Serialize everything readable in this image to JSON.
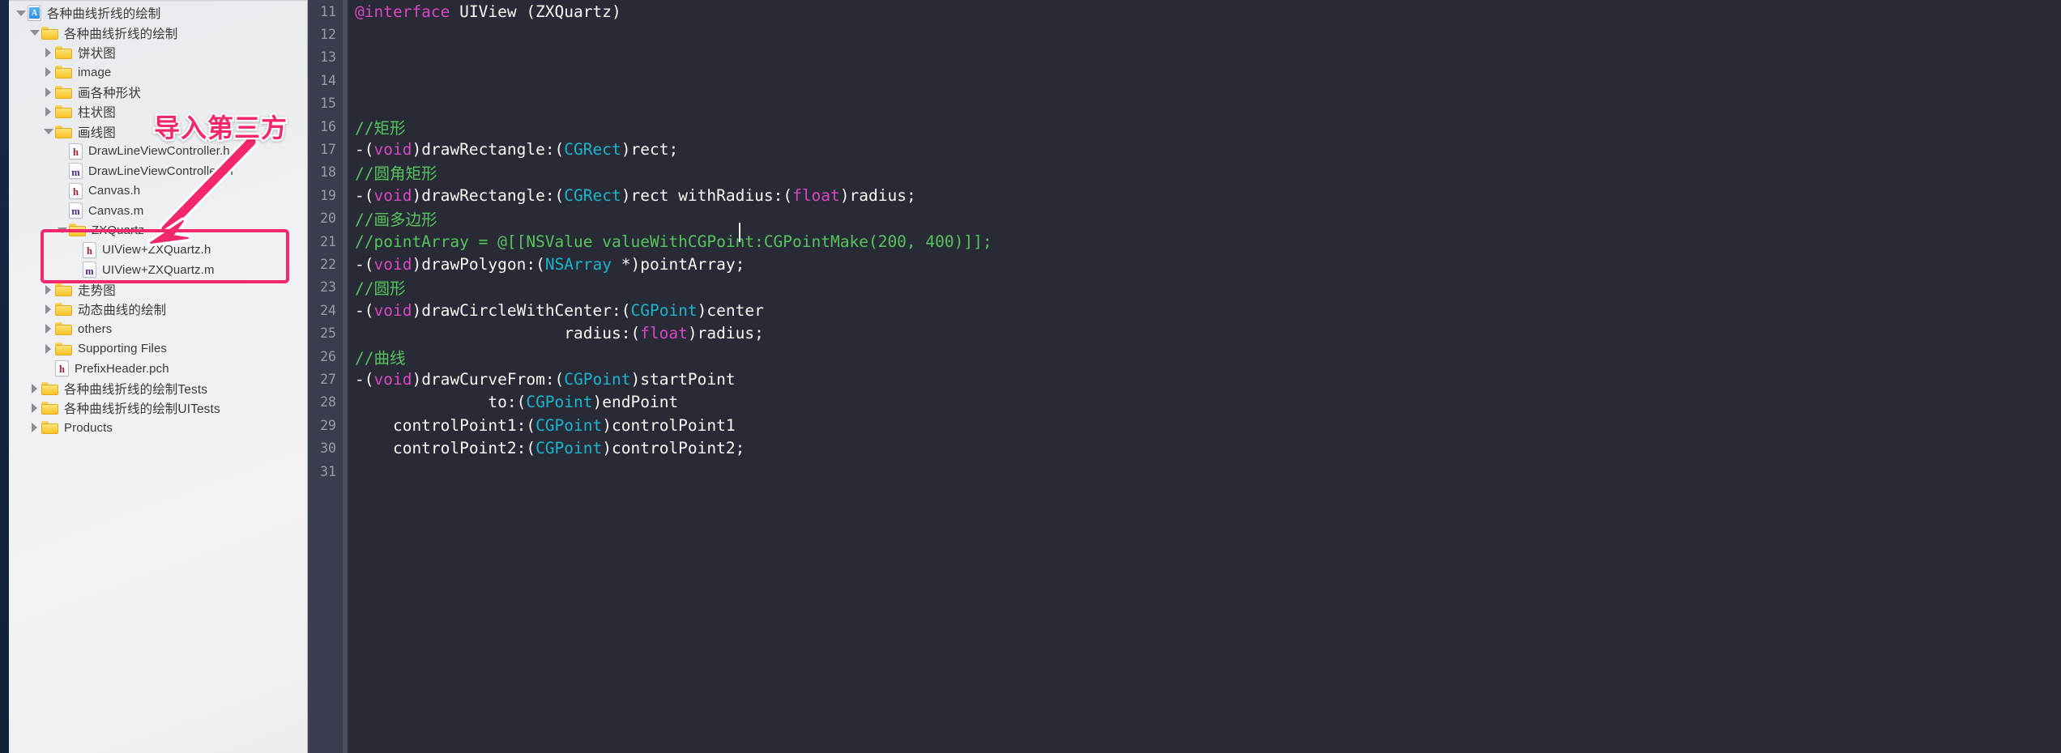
{
  "sidebar": {
    "name": "project-navigator",
    "items": [
      {
        "indent": 0,
        "twisty": "open",
        "icon": "app-icon",
        "label": "各种曲线折线的绘制"
      },
      {
        "indent": 1,
        "twisty": "open",
        "icon": "folder-icon",
        "label": "各种曲线折线的绘制"
      },
      {
        "indent": 2,
        "twisty": "closed",
        "icon": "folder-icon",
        "label": "饼状图"
      },
      {
        "indent": 2,
        "twisty": "closed",
        "icon": "folder-icon",
        "label": "image"
      },
      {
        "indent": 2,
        "twisty": "closed",
        "icon": "folder-icon",
        "label": "画各种形状"
      },
      {
        "indent": 2,
        "twisty": "closed",
        "icon": "folder-icon",
        "label": "柱状图"
      },
      {
        "indent": 2,
        "twisty": "open",
        "icon": "folder-icon",
        "label": "画线图"
      },
      {
        "indent": 3,
        "twisty": "none",
        "icon": "header-file-icon",
        "label": "DrawLineViewController.h"
      },
      {
        "indent": 3,
        "twisty": "none",
        "icon": "source-file-icon",
        "label": "DrawLineViewController.m"
      },
      {
        "indent": 3,
        "twisty": "none",
        "icon": "header-file-icon",
        "label": "Canvas.h"
      },
      {
        "indent": 3,
        "twisty": "none",
        "icon": "source-file-icon",
        "label": "Canvas.m"
      },
      {
        "indent": 3,
        "twisty": "open",
        "icon": "folder-icon",
        "label": "ZXQuartz"
      },
      {
        "indent": 4,
        "twisty": "none",
        "icon": "header-file-icon",
        "label": "UIView+ZXQuartz.h"
      },
      {
        "indent": 4,
        "twisty": "none",
        "icon": "source-file-icon",
        "label": "UIView+ZXQuartz.m"
      },
      {
        "indent": 2,
        "twisty": "closed",
        "icon": "folder-icon",
        "label": "走势图"
      },
      {
        "indent": 2,
        "twisty": "closed",
        "icon": "folder-icon",
        "label": "动态曲线的绘制"
      },
      {
        "indent": 2,
        "twisty": "closed",
        "icon": "folder-icon",
        "label": "others"
      },
      {
        "indent": 2,
        "twisty": "closed",
        "icon": "folder-icon",
        "label": "Supporting Files"
      },
      {
        "indent": 2,
        "twisty": "none",
        "icon": "header-file-icon",
        "label": "PrefixHeader.pch"
      },
      {
        "indent": 1,
        "twisty": "closed",
        "icon": "folder-icon",
        "label": "各种曲线折线的绘制Tests"
      },
      {
        "indent": 1,
        "twisty": "closed",
        "icon": "folder-icon",
        "label": "各种曲线折线的绘制UITests"
      },
      {
        "indent": 1,
        "twisty": "closed",
        "icon": "folder-icon",
        "label": "Products"
      }
    ]
  },
  "annotation": {
    "text": "导入第三方",
    "color": "#f5276c",
    "outline_color": "#ffffff",
    "highlight_target": "ZXQuartz"
  },
  "editor": {
    "background": "#282a36",
    "gutter_background": "#3a3d4d",
    "line_number_color": "#9a9ca6",
    "first_line_number": 11,
    "last_line_number": 31,
    "colors": {
      "keyword": "#d946c4",
      "comment": "#56c45c",
      "type": "#19b6cf",
      "plain": "#f8f8f2"
    },
    "line_numbers": [
      11,
      12,
      13,
      14,
      15,
      16,
      17,
      18,
      19,
      20,
      21,
      22,
      23,
      24,
      25,
      26,
      27,
      28,
      29,
      30,
      31
    ],
    "lines": [
      {
        "n": 11,
        "tokens": [
          {
            "t": "@interface ",
            "c": "kw"
          },
          {
            "t": "UIView (ZXQuartz)",
            "c": "pl"
          }
        ]
      },
      {
        "n": 12,
        "tokens": []
      },
      {
        "n": 13,
        "tokens": []
      },
      {
        "n": 14,
        "tokens": []
      },
      {
        "n": 15,
        "tokens": []
      },
      {
        "n": 16,
        "tokens": [
          {
            "t": "//矩形",
            "c": "cm"
          }
        ]
      },
      {
        "n": 17,
        "tokens": [
          {
            "t": "-(",
            "c": "pl"
          },
          {
            "t": "void",
            "c": "kw"
          },
          {
            "t": ")drawRectangle:(",
            "c": "pl"
          },
          {
            "t": "CGRect",
            "c": "ty"
          },
          {
            "t": ")rect;",
            "c": "pl"
          }
        ]
      },
      {
        "n": 18,
        "tokens": [
          {
            "t": "//圆角矩形",
            "c": "cm"
          }
        ]
      },
      {
        "n": 19,
        "tokens": [
          {
            "t": "-(",
            "c": "pl"
          },
          {
            "t": "void",
            "c": "kw"
          },
          {
            "t": ")drawRectangle:(",
            "c": "pl"
          },
          {
            "t": "CGRect",
            "c": "ty"
          },
          {
            "t": ")rect withRadius:(",
            "c": "pl"
          },
          {
            "t": "float",
            "c": "kw"
          },
          {
            "t": ")radius;",
            "c": "pl"
          }
        ]
      },
      {
        "n": 20,
        "tokens": [
          {
            "t": "//画多边形",
            "c": "cm"
          }
        ]
      },
      {
        "n": 21,
        "tokens": [
          {
            "t": "//pointArray = @[[NSValue valueWithCGPoint:CGPointMake(200, 400)]];",
            "c": "cm"
          }
        ]
      },
      {
        "n": 22,
        "tokens": [
          {
            "t": "-(",
            "c": "pl"
          },
          {
            "t": "void",
            "c": "kw"
          },
          {
            "t": ")drawPolygon:(",
            "c": "pl"
          },
          {
            "t": "NSArray",
            "c": "ty"
          },
          {
            "t": " *)pointArray;",
            "c": "pl"
          }
        ]
      },
      {
        "n": 23,
        "tokens": [
          {
            "t": "//圆形",
            "c": "cm"
          }
        ]
      },
      {
        "n": 24,
        "tokens": [
          {
            "t": "-(",
            "c": "pl"
          },
          {
            "t": "void",
            "c": "kw"
          },
          {
            "t": ")drawCircleWithCenter:(",
            "c": "pl"
          },
          {
            "t": "CGPoint",
            "c": "ty"
          },
          {
            "t": ")center",
            "c": "pl"
          }
        ]
      },
      {
        "n": 25,
        "tokens": [
          {
            "t": "                      radius:(",
            "c": "pl"
          },
          {
            "t": "float",
            "c": "kw"
          },
          {
            "t": ")radius;",
            "c": "pl"
          }
        ]
      },
      {
        "n": 26,
        "tokens": [
          {
            "t": "//曲线",
            "c": "cm"
          }
        ]
      },
      {
        "n": 27,
        "tokens": [
          {
            "t": "-(",
            "c": "pl"
          },
          {
            "t": "void",
            "c": "kw"
          },
          {
            "t": ")drawCurveFrom:(",
            "c": "pl"
          },
          {
            "t": "CGPoint",
            "c": "ty"
          },
          {
            "t": ")startPoint",
            "c": "pl"
          }
        ]
      },
      {
        "n": 28,
        "tokens": [
          {
            "t": "              to:(",
            "c": "pl"
          },
          {
            "t": "CGPoint",
            "c": "ty"
          },
          {
            "t": ")endPoint",
            "c": "pl"
          }
        ]
      },
      {
        "n": 29,
        "tokens": [
          {
            "t": "    controlPoint1:(",
            "c": "pl"
          },
          {
            "t": "CGPoint",
            "c": "ty"
          },
          {
            "t": ")controlPoint1",
            "c": "pl"
          }
        ]
      },
      {
        "n": 30,
        "tokens": [
          {
            "t": "    controlPoint2:(",
            "c": "pl"
          },
          {
            "t": "CGPoint",
            "c": "ty"
          },
          {
            "t": ")controlPoint2;",
            "c": "pl"
          }
        ]
      },
      {
        "n": 31,
        "tokens": []
      }
    ]
  }
}
